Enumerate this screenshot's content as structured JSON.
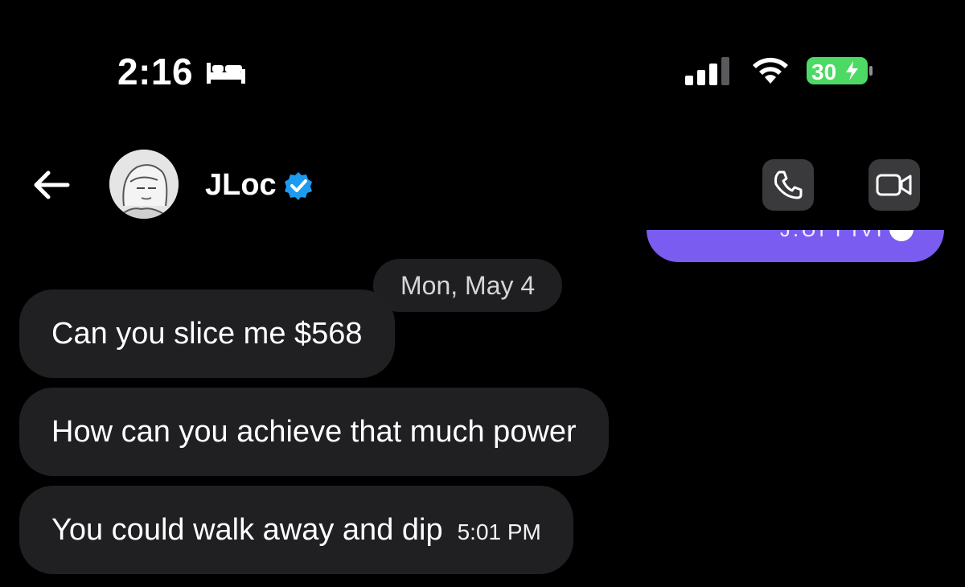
{
  "status_bar": {
    "time": "2:16",
    "focus_mode_icon": "bed-icon",
    "battery_level": "30"
  },
  "header": {
    "back_icon": "arrow-left-icon",
    "contact_name": "JLoc",
    "verified_icon": "verified-badge-icon",
    "call_icon": "phone-icon",
    "video_icon": "video-camera-icon"
  },
  "thread": {
    "sent_partial": {
      "visible_text_fragment": "J.UI I IVI"
    },
    "date_separator": "Mon, May 4",
    "messages": [
      {
        "text": "Can you slice me $568"
      },
      {
        "text": "How can you achieve that much power"
      },
      {
        "text": "You could walk away and dip",
        "timestamp": "5:01 PM"
      }
    ]
  },
  "colors": {
    "background": "#000000",
    "bubble_received": "#202022",
    "bubble_sent": "#7a5cf0",
    "battery_fill": "#4cd964",
    "verified_blue": "#1d9bf0",
    "header_button_bg": "#3a3a3c"
  }
}
